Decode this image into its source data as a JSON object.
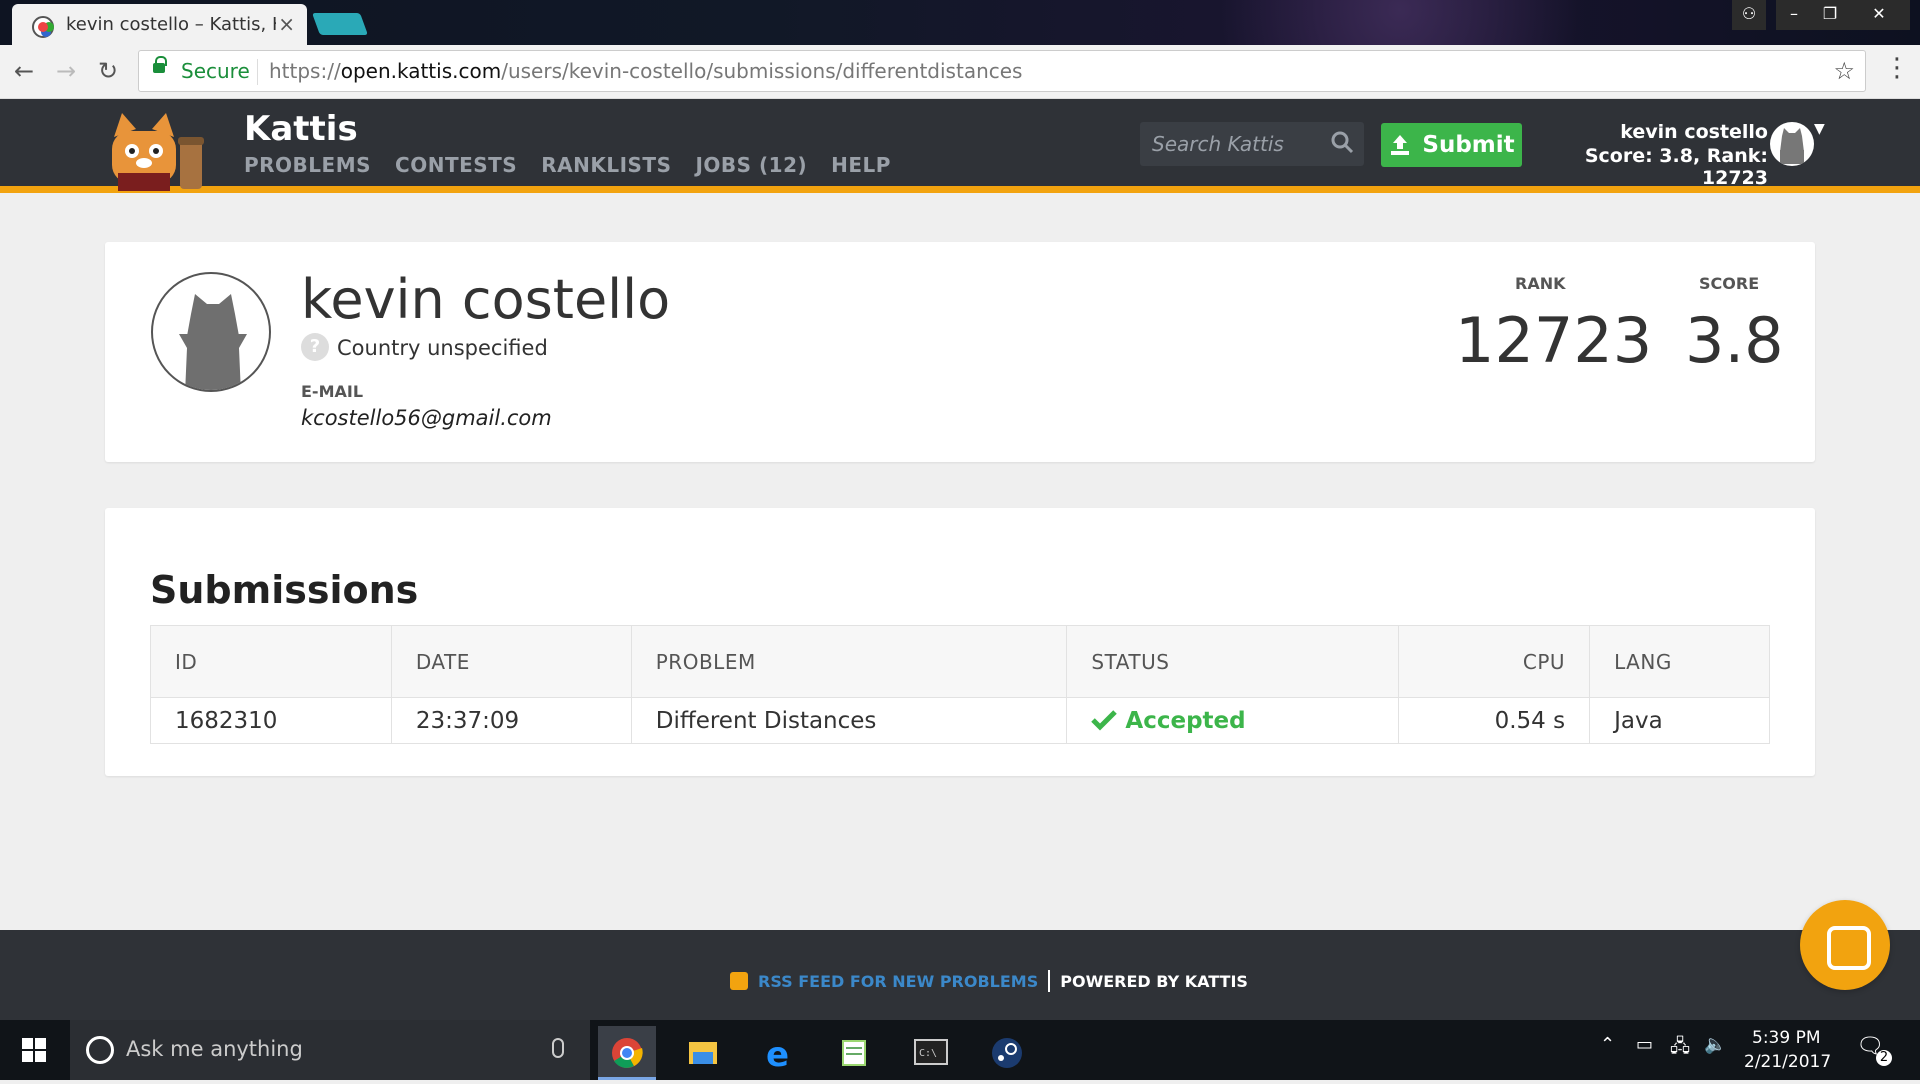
{
  "browser": {
    "tab_title": "kevin costello – Kattis, Ka",
    "secure_label": "Secure",
    "url_scheme": "https://",
    "url_host": "open.kattis.com",
    "url_path": "/users/kevin-costello/submissions/differentdistances"
  },
  "header": {
    "brand": "Kattis",
    "nav": [
      "PROBLEMS",
      "CONTESTS",
      "RANKLISTS",
      "JOBS (12)",
      "HELP"
    ],
    "search_placeholder": "Search Kattis",
    "submit_label": "Submit",
    "user_name": "kevin costello",
    "user_score_line": "Score: 3.8, Rank: 12723"
  },
  "profile": {
    "name": "kevin costello",
    "country": "Country unspecified",
    "email_label": "E-MAIL",
    "email": "kcostello56@gmail.com",
    "rank_label": "RANK",
    "rank": "12723",
    "score_label": "SCORE",
    "score": "3.8"
  },
  "submissions": {
    "title": "Submissions",
    "columns": [
      "ID",
      "DATE",
      "PROBLEM",
      "STATUS",
      "CPU",
      "LANG"
    ],
    "rows": [
      {
        "id": "1682310",
        "date": "23:37:09",
        "problem": "Different Distances",
        "status": "Accepted",
        "cpu": "0.54 s",
        "lang": "Java"
      }
    ]
  },
  "footer": {
    "rss": "RSS FEED FOR NEW PROBLEMS",
    "powered": "POWERED BY KATTIS"
  },
  "taskbar": {
    "search_placeholder": "Ask me anything",
    "time": "5:39 PM",
    "date": "2/21/2017",
    "notification_count": "2"
  },
  "colors": {
    "accent": "#f2a30f",
    "header_bg": "#2f3237",
    "success": "#3cb54a",
    "link": "#3b88c9"
  },
  "icons": [
    "back-arrow-icon",
    "forward-arrow-icon",
    "reload-icon",
    "lock-icon",
    "star-icon",
    "search-icon",
    "upload-icon",
    "check-icon",
    "rss-icon",
    "chat-icon"
  ]
}
